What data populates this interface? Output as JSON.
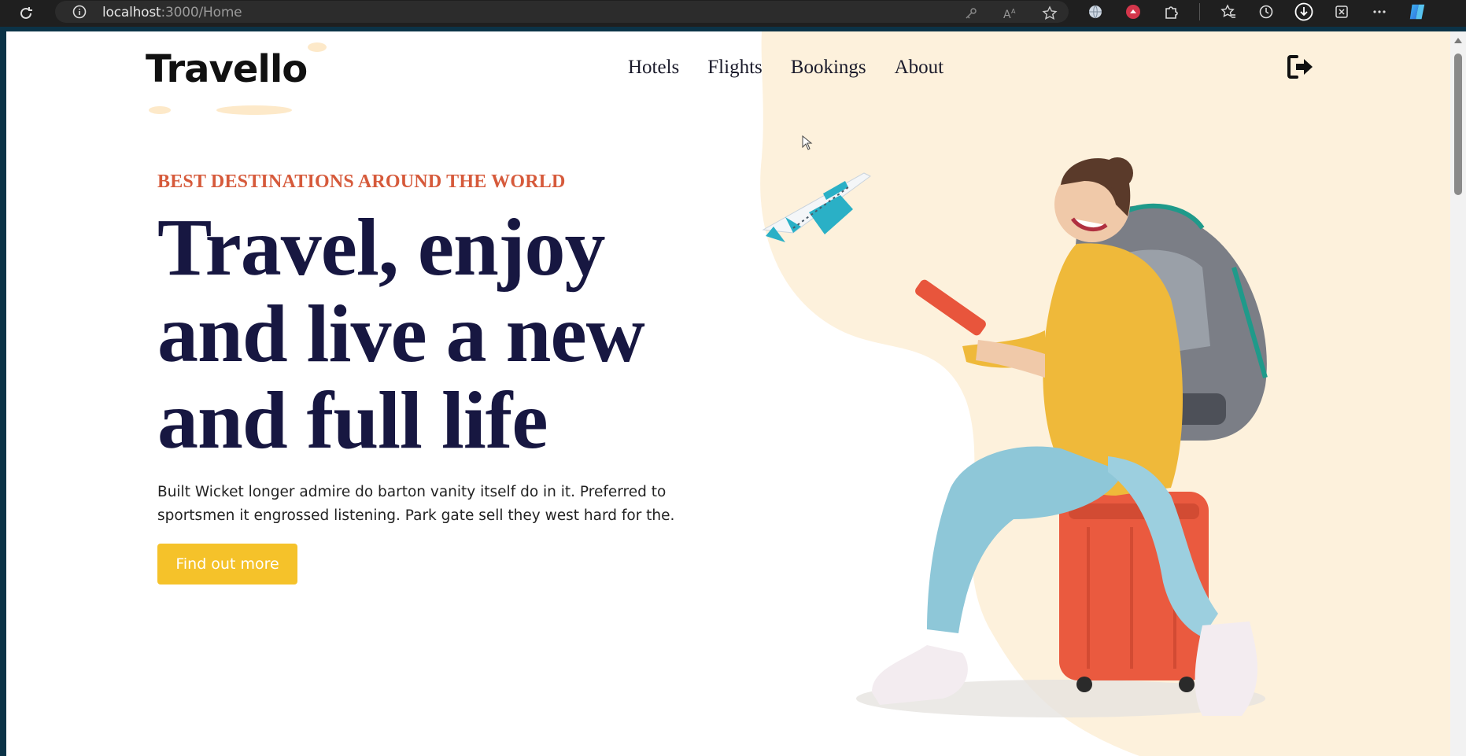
{
  "browser": {
    "url_host": "localhost",
    "url_path": ":3000/Home",
    "icons": [
      "reload-icon",
      "site-info-icon",
      "key-icon",
      "read-aloud-icon",
      "favorite-star-icon",
      "globe-icon",
      "extension-red-icon",
      "puzzle-icon",
      "favorites-icon",
      "history-icon",
      "downloads-icon",
      "screenshot-icon",
      "more-icon",
      "copilot-icon"
    ]
  },
  "header": {
    "logo": "Travello",
    "nav": [
      {
        "label": "Hotels"
      },
      {
        "label": "Flights"
      },
      {
        "label": "Bookings"
      },
      {
        "label": "About"
      }
    ],
    "logout_icon": "logout-icon"
  },
  "hero": {
    "eyebrow": "BEST DESTINATIONS AROUND THE WORLD",
    "headline_line1": "Travel, enjoy",
    "headline_line2": "and live a new",
    "headline_line3": "and full life",
    "description_line1": "Built Wicket longer admire do barton vanity itself do in it. Preferred to",
    "description_line2": "sportsmen it engrossed listening. Park gate sell they west hard for the.",
    "cta_label": "Find out more"
  },
  "colors": {
    "accent": "#f5c22a",
    "eyebrow": "#d65a3b",
    "headline": "#171741",
    "blob": "#fdf1dc"
  }
}
